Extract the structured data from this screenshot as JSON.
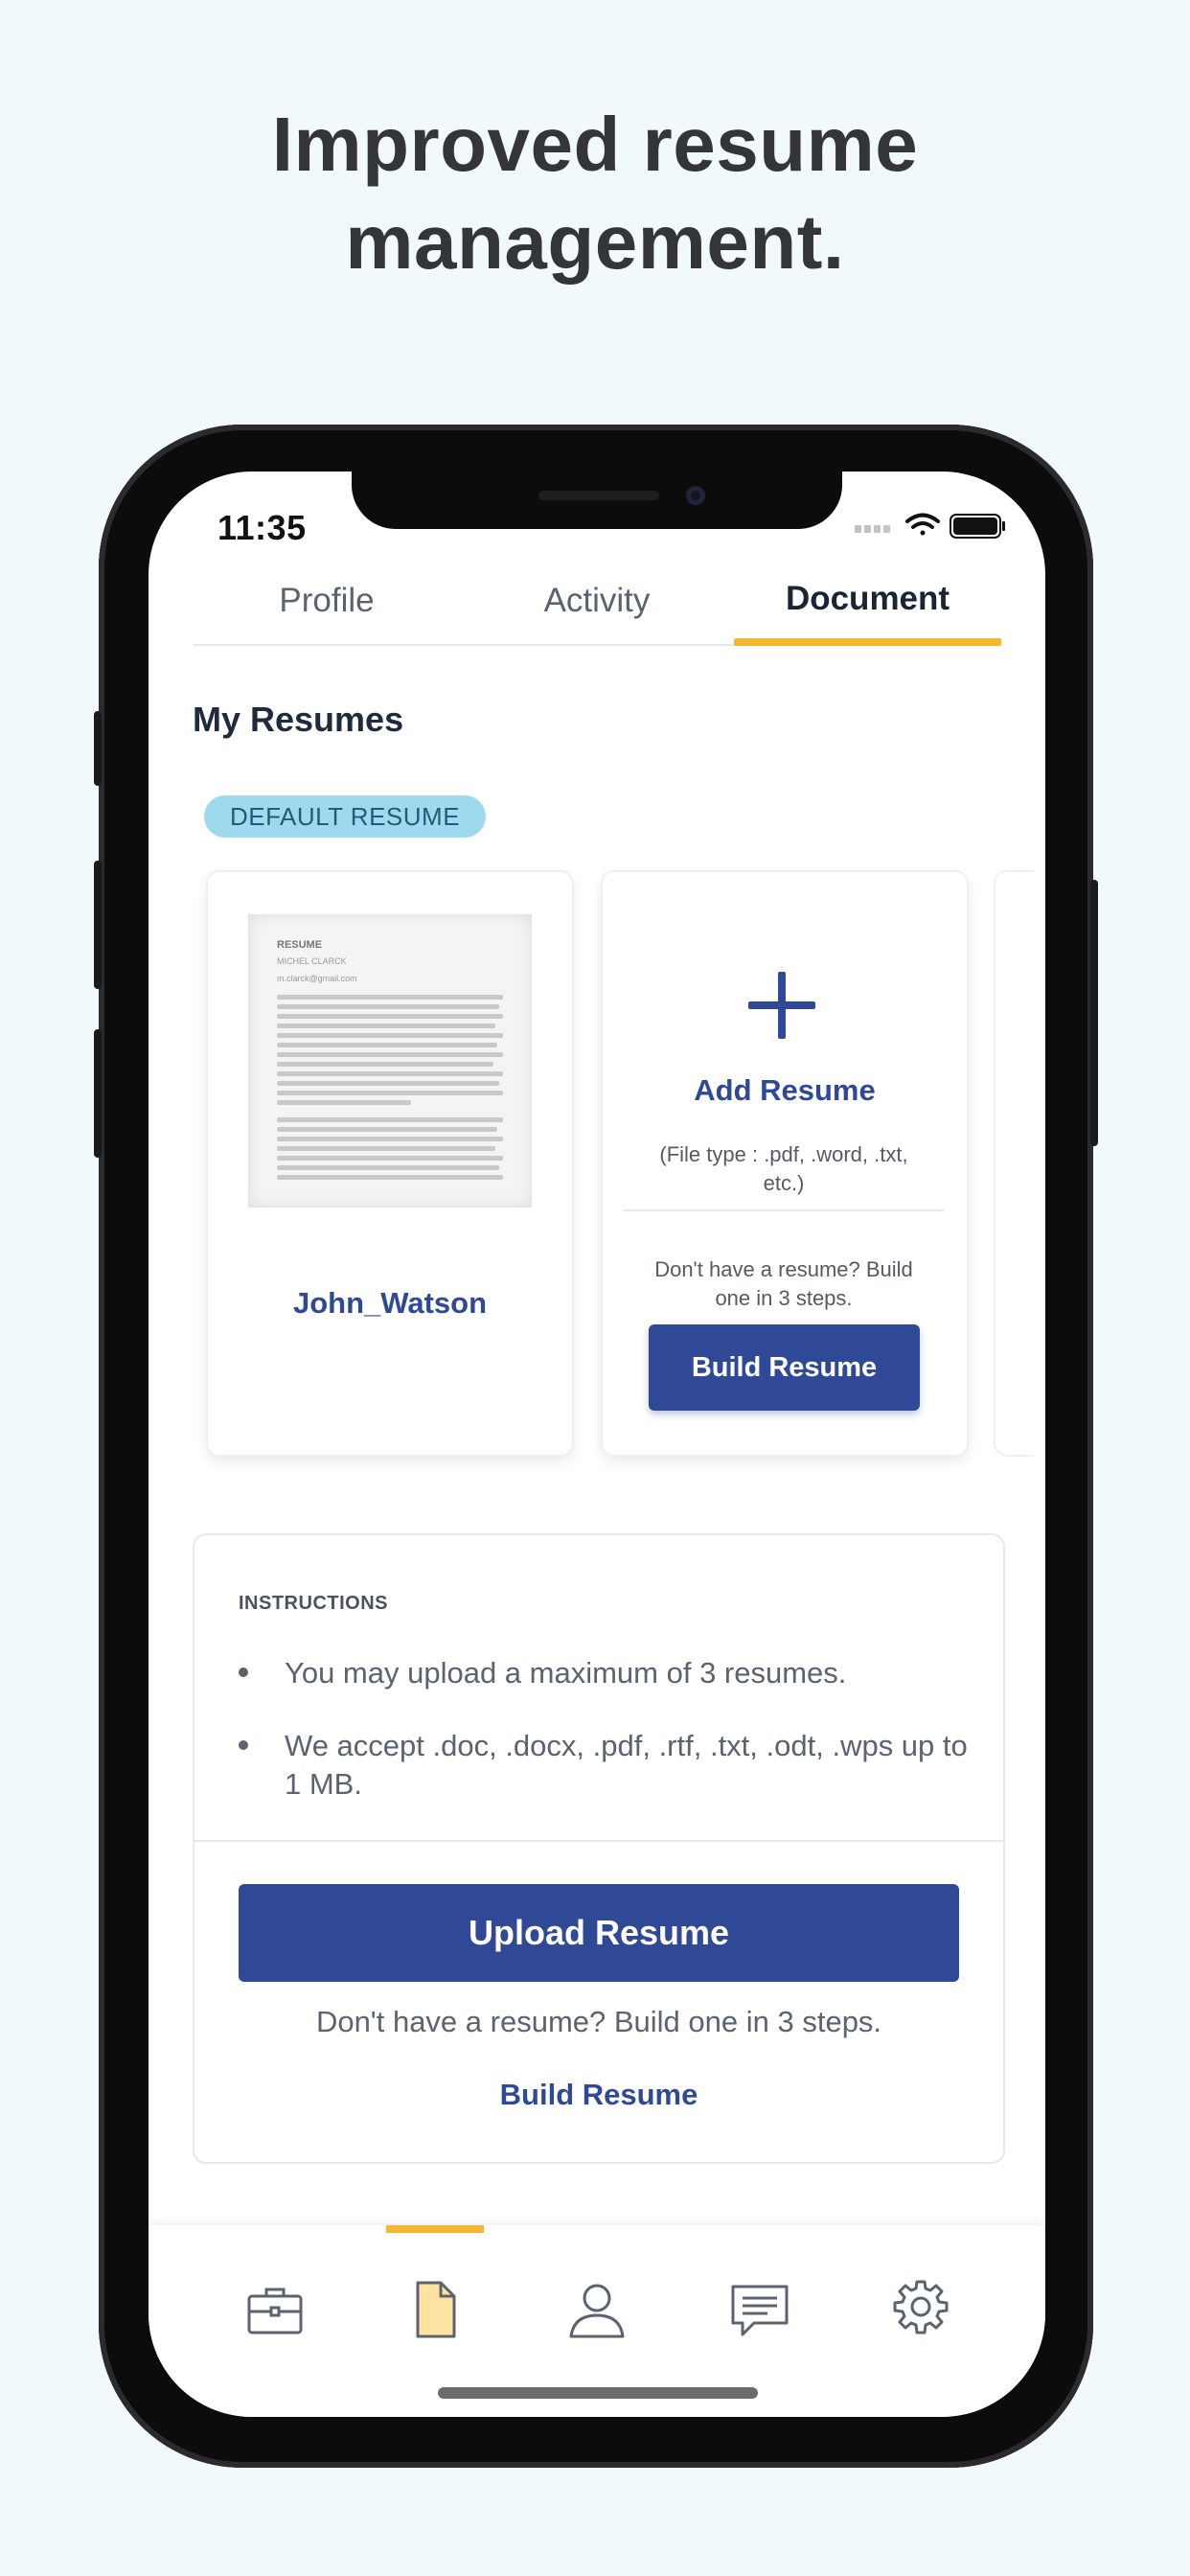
{
  "headline": {
    "line1": "Improved resume",
    "line2": "management."
  },
  "status_bar": {
    "time": "11:35"
  },
  "tabs": [
    {
      "label": "Profile",
      "active": false
    },
    {
      "label": "Activity",
      "active": false
    },
    {
      "label": "Document",
      "active": true
    }
  ],
  "section_title": "My Resumes",
  "default_badge": "DEFAULT RESUME",
  "resume_card": {
    "name": "John_Watson",
    "thumbnail": {
      "title": "RESUME",
      "person": "MICHEL CLARCK",
      "email": "m.clarck@gmail.com"
    }
  },
  "add_card": {
    "title": "Add Resume",
    "filetype": "(File type : .pdf, .word, .txt, etc.)",
    "no_resume": "Don't have a resume? Build one in 3 steps.",
    "build_label": "Build Resume"
  },
  "instructions": {
    "heading": "INSTRUCTIONS",
    "items": [
      "You may upload a maximum of 3 resumes.",
      "We accept .doc, .docx, .pdf, .rtf, .txt, .odt, .wps up to 1 MB."
    ],
    "upload_label": "Upload Resume",
    "no_resume": "Don't have a resume? Build one in 3 steps.",
    "build_link": "Build Resume"
  },
  "bottom_nav": [
    {
      "icon": "briefcase-icon",
      "active": false
    },
    {
      "icon": "document-icon",
      "active": true
    },
    {
      "icon": "profile-icon",
      "active": false
    },
    {
      "icon": "message-icon",
      "active": false
    },
    {
      "icon": "settings-icon",
      "active": false
    }
  ],
  "colors": {
    "primary": "#2f4996",
    "accent": "#f5b731",
    "badge_bg": "#9fd9ee",
    "page_bg": "#f1f9fc"
  }
}
